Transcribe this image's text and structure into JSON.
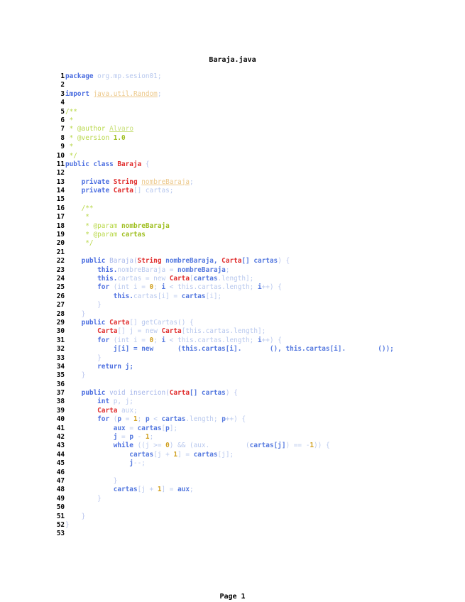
{
  "document": {
    "title": "Baraja.java",
    "footer": "Page 1"
  },
  "lines": [
    {
      "n": "1",
      "t": [
        [
          "package ",
          "kb"
        ],
        [
          "org.mp.sesion01;",
          "n"
        ]
      ]
    },
    {
      "n": "2",
      "t": []
    },
    {
      "n": "3",
      "t": [
        [
          "import ",
          "kb"
        ],
        [
          "java.util.Random",
          "uo"
        ],
        [
          ";",
          "n"
        ]
      ]
    },
    {
      "n": "4",
      "t": []
    },
    {
      "n": "5",
      "t": [
        [
          "/**",
          "c"
        ]
      ]
    },
    {
      "n": "6",
      "t": [
        [
          " *",
          "c"
        ]
      ]
    },
    {
      "n": "7",
      "t": [
        [
          " * @author ",
          "c"
        ],
        [
          "Alvaro",
          "u"
        ]
      ]
    },
    {
      "n": "8",
      "t": [
        [
          " * @version ",
          "c"
        ],
        [
          "1.0",
          "cb"
        ]
      ]
    },
    {
      "n": "9",
      "t": [
        [
          " *",
          "c"
        ]
      ]
    },
    {
      "n": "10",
      "t": [
        [
          " */",
          "c"
        ]
      ]
    },
    {
      "n": "11",
      "t": [
        [
          "public class ",
          "kb"
        ],
        [
          "Baraja",
          "t"
        ],
        [
          " {",
          "p"
        ]
      ]
    },
    {
      "n": "12",
      "t": []
    },
    {
      "n": "13",
      "t": [
        [
          "    private ",
          "kb"
        ],
        [
          "String",
          "t"
        ],
        [
          " ",
          "n"
        ],
        [
          "nombreBaraja",
          "uo"
        ],
        [
          ";",
          "n"
        ]
      ]
    },
    {
      "n": "14",
      "t": [
        [
          "    private ",
          "kb"
        ],
        [
          "Carta",
          "t"
        ],
        [
          "[] cartas;",
          "n"
        ]
      ]
    },
    {
      "n": "15",
      "t": []
    },
    {
      "n": "16",
      "t": [
        [
          "    /**",
          "c"
        ]
      ]
    },
    {
      "n": "17",
      "t": [
        [
          "     *",
          "c"
        ]
      ]
    },
    {
      "n": "18",
      "t": [
        [
          "     * @param ",
          "c"
        ],
        [
          "nombreBaraja",
          "cb"
        ]
      ]
    },
    {
      "n": "19",
      "t": [
        [
          "     * @param ",
          "c"
        ],
        [
          "cartas",
          "cb"
        ]
      ]
    },
    {
      "n": "20",
      "t": [
        [
          "     */",
          "c"
        ]
      ]
    },
    {
      "n": "21",
      "t": []
    },
    {
      "n": "22",
      "t": [
        [
          "    public ",
          "kb"
        ],
        [
          "Baraja(",
          "g"
        ],
        [
          "String",
          "t"
        ],
        [
          " nombreBaraja, ",
          "nb"
        ],
        [
          "Carta",
          "t"
        ],
        [
          "[] cartas",
          "nb"
        ],
        [
          ") {",
          "p"
        ]
      ]
    },
    {
      "n": "23",
      "t": [
        [
          "        this.",
          "kb"
        ],
        [
          "nombreBaraja = ",
          "n"
        ],
        [
          "nombreBaraja",
          "nb"
        ],
        [
          ";",
          "n"
        ]
      ]
    },
    {
      "n": "24",
      "t": [
        [
          "        this.",
          "kb"
        ],
        [
          "cartas = new ",
          "n"
        ],
        [
          "Carta",
          "t"
        ],
        [
          "[",
          "n"
        ],
        [
          "cartas",
          "nb"
        ],
        [
          ".length];",
          "n"
        ]
      ]
    },
    {
      "n": "25",
      "t": [
        [
          "        for ",
          "kb"
        ],
        [
          "(int i = ",
          "n"
        ],
        [
          "0",
          "num"
        ],
        [
          "; ",
          "n"
        ],
        [
          "i",
          "nb"
        ],
        [
          " < this.cartas.length; ",
          "n"
        ],
        [
          "i",
          "nb"
        ],
        [
          "++) {",
          "n"
        ]
      ]
    },
    {
      "n": "26",
      "t": [
        [
          "            this.",
          "kb"
        ],
        [
          "cartas[i] = ",
          "n"
        ],
        [
          "cartas",
          "nb"
        ],
        [
          "[i];",
          "n"
        ]
      ]
    },
    {
      "n": "27",
      "t": [
        [
          "        }",
          "p"
        ]
      ]
    },
    {
      "n": "28",
      "t": [
        [
          "    }",
          "p"
        ]
      ]
    },
    {
      "n": "29",
      "t": [
        [
          "    public ",
          "kb"
        ],
        [
          "Carta",
          "t"
        ],
        [
          "[] getCartas() {",
          "n"
        ]
      ]
    },
    {
      "n": "30",
      "t": [
        [
          "        ",
          "n"
        ],
        [
          "Carta",
          "t"
        ],
        [
          "[] j = new ",
          "n"
        ],
        [
          "Carta",
          "t"
        ],
        [
          "[this.cartas.length];",
          "n"
        ]
      ]
    },
    {
      "n": "31",
      "t": [
        [
          "        for ",
          "kb"
        ],
        [
          "(int i = ",
          "n"
        ],
        [
          "0",
          "num"
        ],
        [
          "; ",
          "n"
        ],
        [
          "i",
          "nb"
        ],
        [
          " < this.cartas.length; ",
          "n"
        ],
        [
          "i",
          "nb"
        ],
        [
          "++) {",
          "n"
        ]
      ]
    },
    {
      "n": "32",
      "t": [
        [
          "            j[i] = new      (this.cartas[i].       (), this.cartas[i].        ());",
          "nb"
        ]
      ]
    },
    {
      "n": "33",
      "t": [
        [
          "        }",
          "p"
        ]
      ]
    },
    {
      "n": "34",
      "t": [
        [
          "        return ",
          "kb"
        ],
        [
          "j;",
          "nb"
        ]
      ]
    },
    {
      "n": "35",
      "t": [
        [
          "    }",
          "p"
        ]
      ]
    },
    {
      "n": "36",
      "t": []
    },
    {
      "n": "37",
      "t": [
        [
          "    public ",
          "kb"
        ],
        [
          "void insercion(",
          "g"
        ],
        [
          "Carta",
          "t"
        ],
        [
          "[] cartas",
          "nb"
        ],
        [
          ") {",
          "p"
        ]
      ]
    },
    {
      "n": "38",
      "t": [
        [
          "        int ",
          "kb"
        ],
        [
          "p, j;",
          "n"
        ]
      ]
    },
    {
      "n": "39",
      "t": [
        [
          "        ",
          "n"
        ],
        [
          "Carta",
          "t"
        ],
        [
          " aux;",
          "n"
        ]
      ]
    },
    {
      "n": "40",
      "t": [
        [
          "        for ",
          "kb"
        ],
        [
          "(",
          "n"
        ],
        [
          "p",
          "nb"
        ],
        [
          " = ",
          "n"
        ],
        [
          "1",
          "num"
        ],
        [
          "; ",
          "n"
        ],
        [
          "p",
          "nb"
        ],
        [
          " < ",
          "n"
        ],
        [
          "cartas",
          "nb"
        ],
        [
          ".length; ",
          "n"
        ],
        [
          "p",
          "nb"
        ],
        [
          "++) {",
          "n"
        ]
      ]
    },
    {
      "n": "41",
      "t": [
        [
          "            aux",
          "nb"
        ],
        [
          " = ",
          "n"
        ],
        [
          "cartas",
          "nb"
        ],
        [
          "[",
          "n"
        ],
        [
          "p",
          "nb"
        ],
        [
          "];",
          "n"
        ]
      ]
    },
    {
      "n": "42",
      "t": [
        [
          "            j",
          "nb"
        ],
        [
          " = ",
          "n"
        ],
        [
          "p",
          "nb"
        ],
        [
          " - ",
          "n"
        ],
        [
          "1",
          "num"
        ],
        [
          ";",
          "n"
        ]
      ]
    },
    {
      "n": "43",
      "t": [
        [
          "            while ",
          "kb"
        ],
        [
          "((j >= ",
          "n"
        ],
        [
          "0",
          "num"
        ],
        [
          ") && (aux.         (",
          "n"
        ],
        [
          "cartas[j]",
          "nb"
        ],
        [
          ") == -",
          "n"
        ],
        [
          "1",
          "num"
        ],
        [
          ")) {",
          "n"
        ]
      ]
    },
    {
      "n": "44",
      "t": [
        [
          "                cartas",
          "nb"
        ],
        [
          "[j + ",
          "n"
        ],
        [
          "1",
          "num"
        ],
        [
          "] = ",
          "n"
        ],
        [
          "cartas",
          "nb"
        ],
        [
          "[j];",
          "n"
        ]
      ]
    },
    {
      "n": "45",
      "t": [
        [
          "                j",
          "nb"
        ],
        [
          "--;",
          "n"
        ]
      ]
    },
    {
      "n": "46",
      "t": []
    },
    {
      "n": "47",
      "t": [
        [
          "            }",
          "p"
        ]
      ]
    },
    {
      "n": "48",
      "t": [
        [
          "            cartas",
          "nb"
        ],
        [
          "[j + ",
          "n"
        ],
        [
          "1",
          "num"
        ],
        [
          "] = ",
          "n"
        ],
        [
          "aux",
          "nb"
        ],
        [
          ";",
          "n"
        ]
      ]
    },
    {
      "n": "49",
      "t": [
        [
          "        }",
          "p"
        ]
      ]
    },
    {
      "n": "50",
      "t": []
    },
    {
      "n": "51",
      "t": [
        [
          "    }",
          "p"
        ]
      ]
    },
    {
      "n": "52",
      "t": [
        [
          "}",
          "p"
        ]
      ]
    },
    {
      "n": "53",
      "t": []
    }
  ]
}
